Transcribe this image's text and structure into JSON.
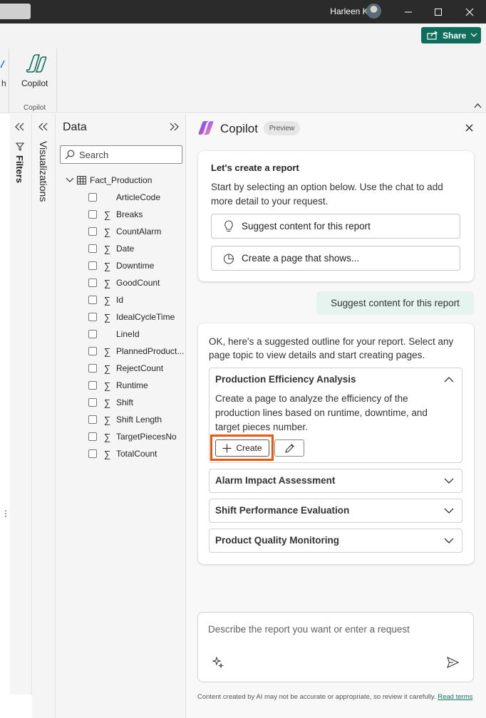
{
  "titlebar": {
    "user_name": "Harleen Kaur"
  },
  "ribbon": {
    "share_label": "Share",
    "partial_label": "h",
    "copilot_button_label": "Copilot",
    "group_label": "Copilot"
  },
  "panes": {
    "filters_label": "Filters",
    "visualizations_label": "Visualizations",
    "data_title": "Data",
    "search_placeholder": "Search",
    "table_name": "Fact_Production",
    "fields": [
      {
        "name": "ArticleCode",
        "sigma": false
      },
      {
        "name": "Breaks",
        "sigma": true
      },
      {
        "name": "CountAlarm",
        "sigma": true
      },
      {
        "name": "Date",
        "sigma": true
      },
      {
        "name": "Downtime",
        "sigma": true
      },
      {
        "name": "GoodCount",
        "sigma": true
      },
      {
        "name": "Id",
        "sigma": true
      },
      {
        "name": "IdealCycleTime",
        "sigma": true
      },
      {
        "name": "LineId",
        "sigma": false
      },
      {
        "name": "PlannedProduct...",
        "sigma": true
      },
      {
        "name": "RejectCount",
        "sigma": true
      },
      {
        "name": "Runtime",
        "sigma": true
      },
      {
        "name": "Shift",
        "sigma": true
      },
      {
        "name": "Shift Length",
        "sigma": true
      },
      {
        "name": "TargetPiecesNo",
        "sigma": true
      },
      {
        "name": "TotalCount",
        "sigma": true
      }
    ]
  },
  "copilot": {
    "title": "Copilot",
    "badge": "Preview",
    "intro_title": "Let's create a report",
    "intro_text_line1": "Start by selecting an option below. Use the chat to add",
    "intro_text_line2": "more detail to your request.",
    "option_suggest": "Suggest content for this report",
    "option_create_page": "Create a page that shows...",
    "user_message": "Suggest content for this report",
    "response_line1": "OK, here's a suggested outline for your report. Select any",
    "response_line2": "page topic to view details and start creating pages.",
    "topics": [
      {
        "title": "Production Efficiency Analysis",
        "expanded": true,
        "desc_line1": "Create a page to analyze the efficiency of the",
        "desc_line2": "production lines based on runtime, downtime, and",
        "desc_line3": "target pieces number."
      },
      {
        "title": "Alarm Impact Assessment",
        "expanded": false
      },
      {
        "title": "Shift Performance Evaluation",
        "expanded": false
      },
      {
        "title": "Product Quality Monitoring",
        "expanded": false
      }
    ],
    "create_label": "Create",
    "input_placeholder": "Describe the report you want or enter a request",
    "disclaimer": "Content created by AI may not be accurate or appropriate, so review it carefully.",
    "disclaimer_link_part1": "Read",
    "disclaimer_link_part2": "terms"
  },
  "colors": {
    "share_green": "#0f6e5b",
    "highlight_orange": "#e8590c",
    "user_bubble": "#e5f4ee",
    "link_teal": "#117865"
  }
}
